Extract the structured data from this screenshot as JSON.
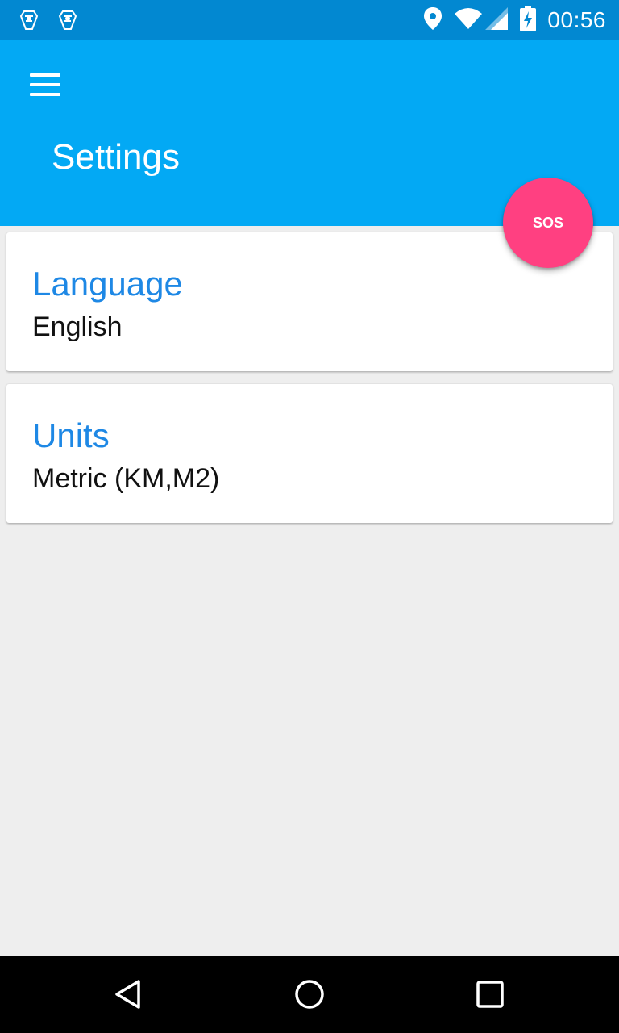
{
  "status_bar": {
    "time": "00:56",
    "notification_icons": [
      "app-notification-icon",
      "app-notification-icon"
    ],
    "status_icons": [
      "location-icon",
      "wifi-icon",
      "signal-icon",
      "battery-charging-icon"
    ]
  },
  "app_bar": {
    "title": "Settings",
    "menu_icon": "hamburger-menu-icon",
    "color": "#03a9f4"
  },
  "fab": {
    "label": "SOS",
    "color": "#ff4081"
  },
  "settings": [
    {
      "title": "Language",
      "value": "English"
    },
    {
      "title": "Units",
      "value": "Metric (KM,M2)"
    }
  ],
  "nav_bar": {
    "buttons": [
      "back-icon",
      "home-icon",
      "recents-icon"
    ]
  },
  "colors": {
    "status_bar": "#0288d1",
    "accent_title": "#1e88e5",
    "background": "#eeeeee"
  }
}
